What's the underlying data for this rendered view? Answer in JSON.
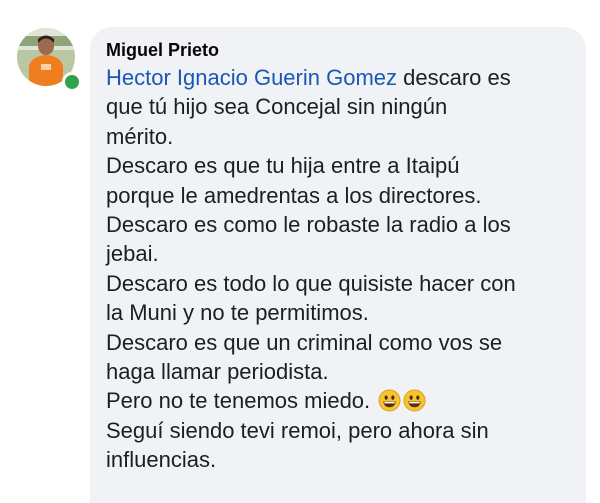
{
  "comment": {
    "author": "Miguel Prieto",
    "mention": "Hector Ignacio Guerin Gomez",
    "lines": [
      " descaro es",
      "que tú hijo sea Concejal sin ningún",
      "mérito.",
      "Descaro es que tu hija entre a Itaipú",
      "porque le amedrentas a los directores.",
      "Descaro es como le robaste la radio a los",
      "jebai.",
      "Descaro es todo lo que quisiste hacer con",
      "la Muni y no te permitimos.",
      "Descaro es que un criminal como vos se",
      "haga llamar periodista.",
      "Pero no te tenemos miedo. ",
      "Seguí siendo tevi remoi, pero ahora sin",
      "influencias."
    ],
    "emoji": [
      "grinning-face-icon",
      "grinning-face-icon"
    ]
  },
  "avatar": {
    "online": true
  },
  "colors": {
    "mention": "#1b58b4",
    "bubble": "#f0f2f5",
    "online": "#31a24c"
  }
}
